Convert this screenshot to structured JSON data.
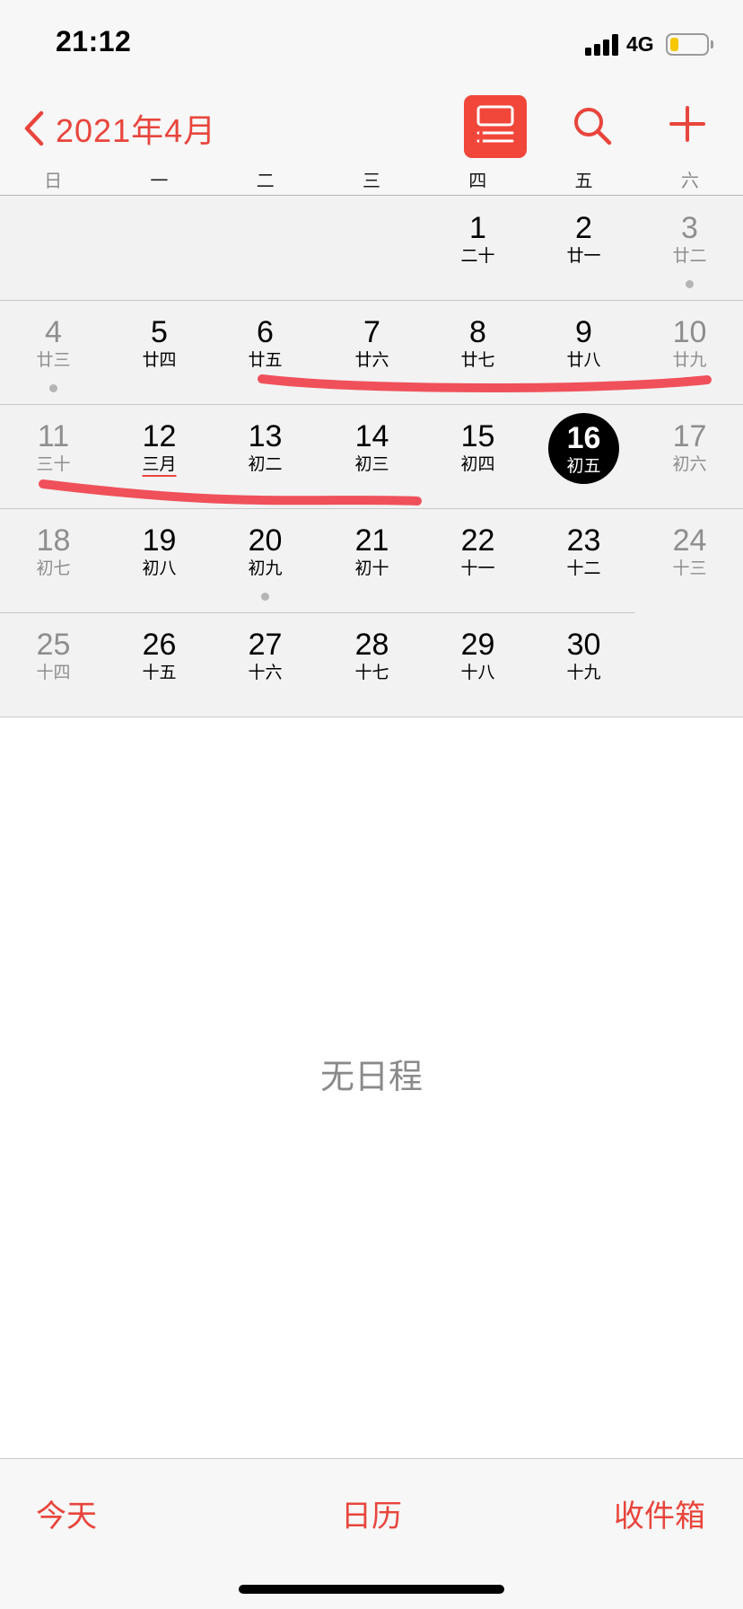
{
  "status_bar": {
    "time": "21:12",
    "network": "4G",
    "battery_level": 0.22
  },
  "nav": {
    "title": "2021年4月",
    "icons": {
      "back": "chevron-left-icon",
      "list": "list-view-icon",
      "search": "search-icon",
      "add": "plus-icon"
    }
  },
  "weekdays": [
    "日",
    "一",
    "二",
    "三",
    "四",
    "五",
    "六"
  ],
  "weeks": [
    [
      null,
      null,
      null,
      null,
      {
        "day": "1",
        "lunar": "二十"
      },
      {
        "day": "2",
        "lunar": "廿一"
      },
      {
        "day": "3",
        "lunar": "廿二",
        "event": true
      }
    ],
    [
      {
        "day": "4",
        "lunar": "廿三",
        "event": true
      },
      {
        "day": "5",
        "lunar": "廿四"
      },
      {
        "day": "6",
        "lunar": "廿五"
      },
      {
        "day": "7",
        "lunar": "廿六"
      },
      {
        "day": "8",
        "lunar": "廿七"
      },
      {
        "day": "9",
        "lunar": "廿八"
      },
      {
        "day": "10",
        "lunar": "廿九"
      }
    ],
    [
      {
        "day": "11",
        "lunar": "三十"
      },
      {
        "day": "12",
        "lunar": "三月",
        "month_start": true
      },
      {
        "day": "13",
        "lunar": "初二"
      },
      {
        "day": "14",
        "lunar": "初三"
      },
      {
        "day": "15",
        "lunar": "初四"
      },
      {
        "day": "16",
        "lunar": "初五",
        "today": true
      },
      {
        "day": "17",
        "lunar": "初六"
      }
    ],
    [
      {
        "day": "18",
        "lunar": "初七"
      },
      {
        "day": "19",
        "lunar": "初八"
      },
      {
        "day": "20",
        "lunar": "初九",
        "event": true
      },
      {
        "day": "21",
        "lunar": "初十"
      },
      {
        "day": "22",
        "lunar": "十一"
      },
      {
        "day": "23",
        "lunar": "十二"
      },
      {
        "day": "24",
        "lunar": "十三"
      }
    ],
    [
      {
        "day": "25",
        "lunar": "十四"
      },
      {
        "day": "26",
        "lunar": "十五"
      },
      {
        "day": "27",
        "lunar": "十六"
      },
      {
        "day": "28",
        "lunar": "十七"
      },
      {
        "day": "29",
        "lunar": "十八"
      },
      {
        "day": "30",
        "lunar": "十九"
      },
      null
    ]
  ],
  "empty_state": "无日程",
  "tab_bar": {
    "today": "今天",
    "calendars": "日历",
    "inbox": "收件箱"
  },
  "colors": {
    "accent": "#e8453c",
    "annotation_stroke": "#f0505a"
  }
}
